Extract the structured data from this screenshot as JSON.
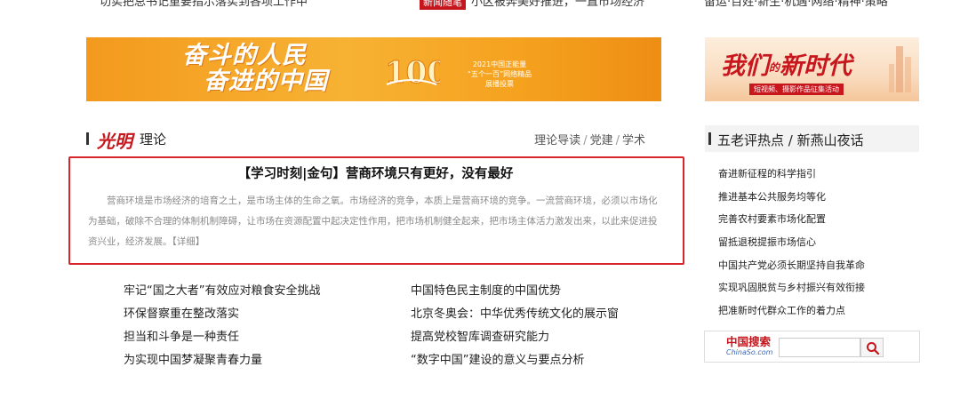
{
  "top_strip": {
    "left_text": "切实把总书记重要指示落实到各项工作中",
    "tag": "新闻随笔",
    "mid_text": "小区被奔美好推进，一直市场经济",
    "right_text": "留运·百姓·新生·机遇·网络·精神·策略"
  },
  "banners": {
    "main": {
      "slogan_line1": "奋斗的人民",
      "slogan_line2": "奋进的中国",
      "info_line1": "2021中国正能量",
      "info_line2": "“五个一百”网络精品",
      "info_line3": "展播投票"
    },
    "side": {
      "title_a": "我们",
      "title_small": "的",
      "title_b": "新时代",
      "subtitle": "短视频、摄影作品征集活动"
    }
  },
  "theory": {
    "logo": "光明",
    "name": "理论",
    "links": [
      "理论导读",
      "党建",
      "学术"
    ],
    "featured": {
      "title": "【学习时刻|金句】营商环境只有更好，没有最好",
      "body": "营商环境是市场经济的培育之土，是市场主体的生命之氧。市场经济的竞争，本质上是营商环境的竞争。一流营商环境，必须以市场化为基础，破除不合理的体制机制障碍，让市场在资源配置中起决定性作用，把市场机制健全起来，把市场主体活力激发出来，以此来促进投资兴业，经济发展。",
      "more": "【详细】"
    },
    "articles_left": [
      "牢记“国之大者”有效应对粮食安全挑战",
      "环保督察重在整改落实",
      "担当和斗争是一种责任",
      "为实现中国梦凝聚青春力量"
    ],
    "articles_right": [
      "中国特色民主制度的中国优势",
      "北京冬奥会：中华优秀传统文化的展示窗",
      "提高党校智库调查研究能力",
      "“数字中国”建设的意义与要点分析"
    ]
  },
  "sidebar": {
    "title": "五老评热点 / 新燕山夜话",
    "items": [
      "奋进新征程的科学指引",
      "推进基本公共服务均等化",
      "完善农村要素市场化配置",
      "留抵退税提振市场信心",
      "中国共产党必须长期坚持自我革命",
      "实现巩固脱贫与乡村振兴有效衔接",
      "把准新时代群众工作的着力点"
    ]
  },
  "search": {
    "brand_cn": "中国搜索",
    "brand_en": "ChinaSo.com",
    "value": "",
    "placeholder": ""
  }
}
